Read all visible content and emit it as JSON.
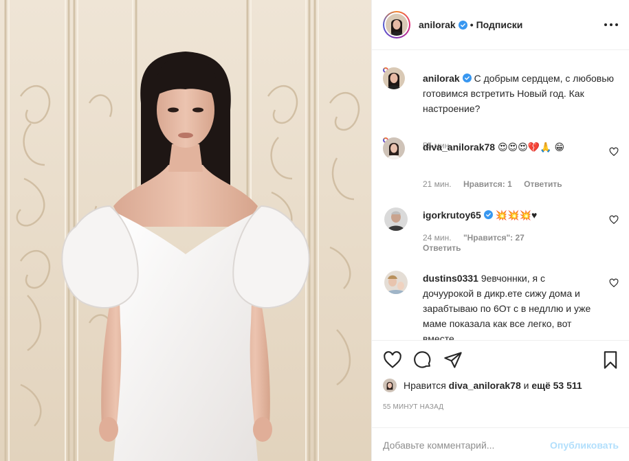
{
  "header": {
    "username": "anilorak",
    "dot": "•",
    "follow_label": "Подписки",
    "verified_icon": "verified-badge-icon",
    "more_icon": "more-options-icon"
  },
  "caption": {
    "username": "anilorak",
    "text": "С добрым сердцем, с любовью готовимся встретить Новый год. Как настроение?",
    "time": "55 мин."
  },
  "comments": [
    {
      "username": "diva_anilorak78",
      "text": "😍😍😍💔🙏 😁",
      "time": "21 мин.",
      "likes": "Нравится: 1",
      "reply": "Ответить"
    },
    {
      "username": "igorkrutoy65",
      "text": "💥💥💥♥",
      "time": "24 мин.",
      "likes": "\"Нравится\": 27",
      "reply": "Ответить"
    },
    {
      "username": "dustins0331",
      "text": "9евчоннки, я с дочуурокой в дикр.ете сижу дома и зарабтываю по 6От с в недллю и уже маме показала как все легко, вот вместе"
    }
  ],
  "footer": {
    "likes_prefix": "Нравится",
    "likes_user": "diva_anilorak78",
    "likes_and": "и",
    "likes_more": "ещё 53 511",
    "time": "55 МИНУТ НАЗАД",
    "comment_placeholder": "Добавьте комментарий...",
    "publish_label": "Опубликовать"
  },
  "colors": {
    "verified": "#3897f0",
    "publish_disabled": "#b2dffc",
    "meta_gray": "#8e8e8e"
  }
}
